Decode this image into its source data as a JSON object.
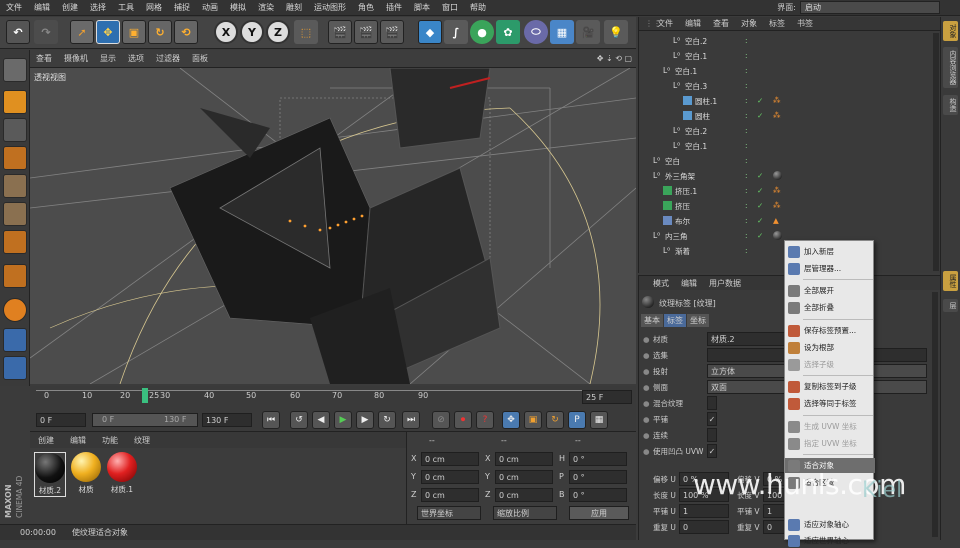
{
  "menubar": {
    "items": [
      "文件",
      "编辑",
      "创建",
      "选择",
      "工具",
      "网格",
      "捕捉",
      "动画",
      "模拟",
      "渲染",
      "雕刻",
      "运动图形",
      "角色",
      "插件",
      "脚本",
      "窗口",
      "帮助"
    ],
    "layout_label": "界面:",
    "layout_value": "启动"
  },
  "toolbar": {
    "axis_x": "X",
    "axis_y": "Y",
    "axis_z": "Z"
  },
  "viewport": {
    "menu": [
      "查看",
      "摄像机",
      "显示",
      "选项",
      "过滤器",
      "面板"
    ],
    "label": "透视视图"
  },
  "timeline": {
    "ticks": [
      "0",
      "10",
      "20",
      "25",
      "30",
      "40",
      "50",
      "60",
      "70",
      "80",
      "90"
    ],
    "current": "25",
    "end": "25 F"
  },
  "transport": {
    "start": "0 F",
    "range_left": "0 F",
    "range_right": "130 F",
    "end": "130 F"
  },
  "materials": {
    "menu": [
      "创建",
      "编辑",
      "功能",
      "纹理"
    ],
    "items": [
      {
        "label": "材质.2",
        "color": "#111111"
      },
      {
        "label": "材质",
        "color": "#f0b020"
      },
      {
        "label": "材质.1",
        "color": "#e02020"
      }
    ]
  },
  "coords": {
    "headers": [
      "--",
      "--",
      "--"
    ],
    "rows": [
      {
        "a": "X",
        "av": "0 cm",
        "b": "X",
        "bv": "0 cm",
        "c": "H",
        "cv": "0 °"
      },
      {
        "a": "Y",
        "av": "0 cm",
        "b": "Y",
        "bv": "0 cm",
        "c": "P",
        "cv": "0 °"
      },
      {
        "a": "Z",
        "av": "0 cm",
        "b": "Z",
        "bv": "0 cm",
        "c": "B",
        "cv": "0 °"
      }
    ],
    "world": "世界坐标",
    "scale": "缩放比例",
    "apply": "应用"
  },
  "statusbar": {
    "time": "00:00:00",
    "text": "使纹理适合对象"
  },
  "brand": {
    "line1": "MAXON",
    "line2": "CINEMA 4D"
  },
  "objmgr": {
    "menu": [
      "文件",
      "编辑",
      "查看",
      "对象",
      "标签",
      "书签"
    ],
    "rows": [
      {
        "name": "空白.2",
        "indent": 2
      },
      {
        "name": "空白.1",
        "indent": 2
      },
      {
        "name": "空白.1",
        "indent": 1
      },
      {
        "name": "空白.3",
        "indent": 2
      },
      {
        "name": "圆柱.1",
        "indent": 3
      },
      {
        "name": "圆柱",
        "indent": 3
      },
      {
        "name": "空白.2",
        "indent": 2
      },
      {
        "name": "空白.1",
        "indent": 2
      },
      {
        "name": "空白",
        "indent": 0
      },
      {
        "name": "外三角架",
        "indent": 0
      },
      {
        "name": "挤压.1",
        "indent": 1
      },
      {
        "name": "挤压",
        "indent": 1
      },
      {
        "name": "布尔",
        "indent": 1
      },
      {
        "name": "内三角",
        "indent": 0
      },
      {
        "name": "渐着",
        "indent": 1
      }
    ]
  },
  "attrmgr": {
    "menu": [
      "模式",
      "编辑",
      "用户数据"
    ],
    "title": "纹理标签 [纹理]",
    "tabs": [
      "基本",
      "标签",
      "坐标"
    ],
    "rows": [
      {
        "label": "材质",
        "value": "材质.2"
      },
      {
        "label": "选集",
        "value": ""
      },
      {
        "label": "投射",
        "value": "立方体"
      },
      {
        "label": "侧面",
        "value": "双面"
      },
      {
        "label": "混合纹理",
        "value": ""
      },
      {
        "label": "平铺",
        "value": "✓"
      },
      {
        "label": "连续",
        "value": ""
      },
      {
        "label": "使用凹凸 UVW",
        "value": "✓"
      }
    ],
    "num_rows": [
      {
        "l1": "偏移 U",
        "v1": "0 %",
        "l2": "偏移 V",
        "v2": "0 %"
      },
      {
        "l1": "长度 U",
        "v1": "100 %",
        "l2": "长度 V",
        "v2": "100 %"
      },
      {
        "l1": "平铺 U",
        "v1": "1",
        "l2": "平铺 V",
        "v2": "1"
      },
      {
        "l1": "重复 U",
        "v1": "0",
        "l2": "重复 V",
        "v2": "0"
      }
    ]
  },
  "ctxmenu": {
    "items": [
      {
        "label": "加入新层",
        "state": "normal"
      },
      {
        "label": "层管理器...",
        "state": "normal"
      },
      {
        "label": "全部展开",
        "state": "normal"
      },
      {
        "label": "全部折叠",
        "state": "normal"
      },
      {
        "label": "保存标签预置...",
        "state": "normal"
      },
      {
        "label": "设为根部",
        "state": "normal"
      },
      {
        "label": "选择子级",
        "state": "disabled"
      },
      {
        "label": "复制标签到子级",
        "state": "normal"
      },
      {
        "label": "选择等同于标签",
        "state": "normal"
      },
      {
        "label": "生成 UVW 坐标",
        "state": "disabled"
      },
      {
        "label": "指定 UVW 坐标",
        "state": "disabled"
      },
      {
        "label": "适合对象",
        "state": "hover"
      },
      {
        "label": "适合区域",
        "state": "normal"
      },
      {
        "label": "适应对象轴心",
        "state": "normal"
      },
      {
        "label": "适应世界轴心",
        "state": "normal"
      }
    ]
  },
  "rstrip": {
    "tabs": [
      "对象",
      "内容浏览器",
      "构造",
      "属性",
      "层"
    ]
  },
  "watermark": {
    "text": "www.hunls.com",
    "logo": "Kiel"
  }
}
